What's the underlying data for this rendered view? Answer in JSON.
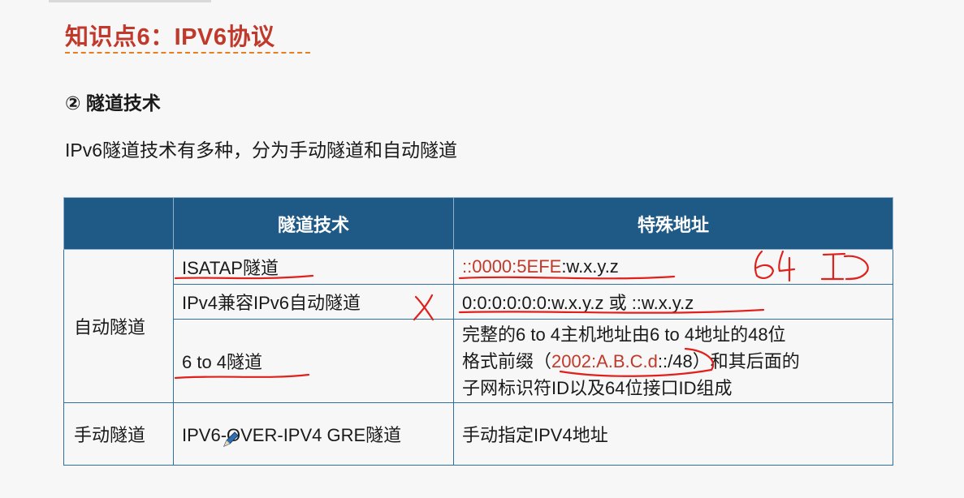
{
  "title": "知识点6：IPV6协议",
  "section": "② 隧道技术",
  "intro": "IPv6隧道技术有多种，分为手动隧道和自动隧道",
  "table": {
    "headers": [
      "",
      "隧道技术",
      "特殊地址"
    ],
    "groups": {
      "auto": "自动隧道",
      "manual": "手动隧道"
    },
    "rows": [
      {
        "tech": "ISATAP隧道",
        "addr_prefix": "::0000:5EFE",
        "addr_suffix": ":w.x.y.z"
      },
      {
        "tech": "IPv4兼容IPv6自动隧道",
        "addr": "0:0:0:0:0:0:w.x.y.z 或 ::w.x.y.z"
      },
      {
        "tech": "6  to 4隧道",
        "addr_line1": "完整的6 to 4主机地址由6 to 4地址的48位",
        "addr_line2_pre": "格式前缀（",
        "addr_line2_red": "2002:A.B.C.d",
        "addr_line2_post": "::/48）和其后面的",
        "addr_line3": "子网标识符ID以及64位接口ID组成"
      },
      {
        "tech": "IPV6-OVER-IPV4 GRE隧道",
        "addr": "手动指定IPV4地址"
      }
    ]
  },
  "annotations": {
    "handwriting_64ID": "64 ID",
    "cross_mark": "X",
    "ink_color": "#e0201b"
  }
}
